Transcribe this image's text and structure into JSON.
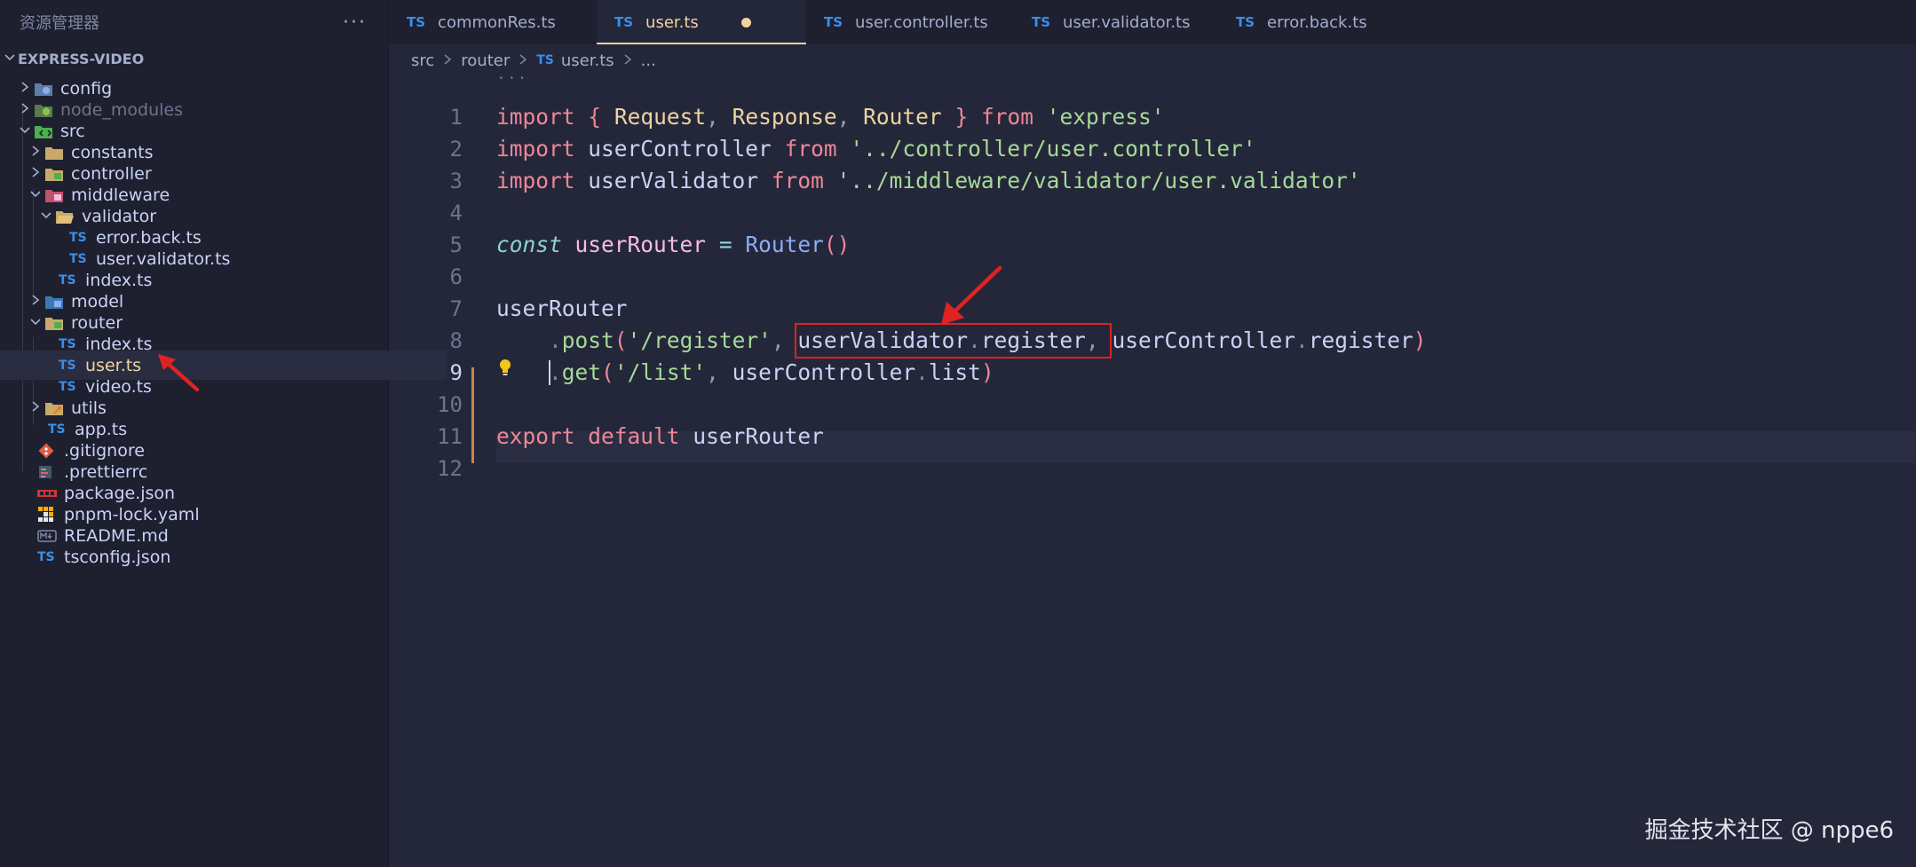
{
  "sidebar": {
    "title": "资源管理器",
    "more": "···",
    "project": "EXPRESS-VIDEO",
    "items": [
      {
        "label": "config"
      },
      {
        "label": "node_modules"
      },
      {
        "label": "src"
      },
      {
        "label": "constants"
      },
      {
        "label": "controller"
      },
      {
        "label": "middleware"
      },
      {
        "label": "validator"
      },
      {
        "label": "error.back.ts"
      },
      {
        "label": "user.validator.ts"
      },
      {
        "label": "index.ts"
      },
      {
        "label": "model"
      },
      {
        "label": "router"
      },
      {
        "label": "index.ts"
      },
      {
        "label": "user.ts"
      },
      {
        "label": "video.ts"
      },
      {
        "label": "utils"
      },
      {
        "label": "app.ts"
      },
      {
        "label": ".gitignore"
      },
      {
        "label": ".prettierrc"
      },
      {
        "label": "package.json"
      },
      {
        "label": "pnpm-lock.yaml"
      },
      {
        "label": "README.md"
      },
      {
        "label": "tsconfig.json"
      }
    ]
  },
  "tabs": [
    {
      "label": "commonRes.ts"
    },
    {
      "label": "user.ts"
    },
    {
      "label": "user.controller.ts"
    },
    {
      "label": "user.validator.ts"
    },
    {
      "label": "error.back.ts"
    }
  ],
  "ts_badge": "TS",
  "breadcrumb": {
    "p1": "src",
    "p2": "router",
    "p3": "user.ts",
    "p4": "..."
  },
  "editor": {
    "sticky": "···",
    "line_numbers": [
      "1",
      "2",
      "3",
      "4",
      "5",
      "6",
      "7",
      "8",
      "9",
      "10",
      "11",
      "12"
    ],
    "t": {
      "import": "import",
      "from": "from",
      "const": "const",
      "export": "export",
      "default": "default",
      "lbrace": "{",
      "rbrace": "}",
      "request": "Request",
      "response": "Response",
      "router": "Router",
      "express": "express",
      "userController": "userController",
      "userValidator": "userValidator",
      "controller_path": "../controller/user.controller",
      "validator_path": "../middleware/validator/user.validator",
      "userRouter": "userRouter",
      "eq": "=",
      "parens": "()",
      "post": "post",
      "get": "get",
      "register_path": "/register",
      "list_path": "/list",
      "register": "register",
      "list": "list"
    }
  },
  "watermark": "掘金技术社区 @ nppe6",
  "colors": {
    "accent": "#eed49f",
    "annotation": "#e02222",
    "ts_blue": "#3b8eea"
  }
}
